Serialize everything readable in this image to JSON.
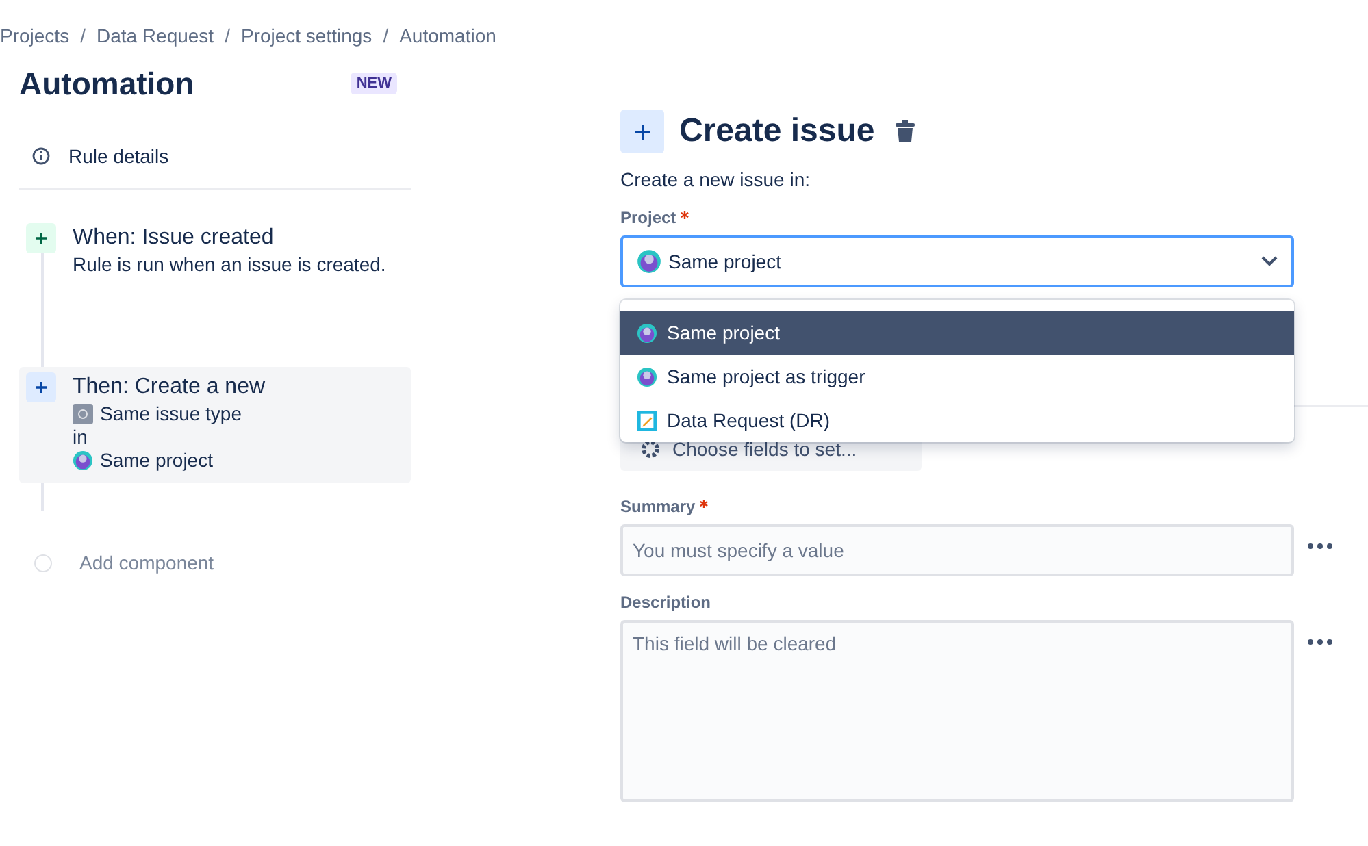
{
  "breadcrumbs": [
    {
      "kind": "link",
      "text": "Projects"
    },
    {
      "kind": "separator",
      "text": "/"
    },
    {
      "kind": "link",
      "text": "Data Request"
    },
    {
      "kind": "separator",
      "text": "/"
    },
    {
      "kind": "link",
      "text": "Project settings"
    },
    {
      "kind": "separator",
      "text": "/"
    },
    {
      "kind": "link",
      "text": "Automation"
    }
  ],
  "page": {
    "title": "Automation",
    "badge": "NEW"
  },
  "rule_details": {
    "label": "Rule details"
  },
  "components": [
    {
      "kind": "trigger",
      "title": "When: Issue created",
      "lines": [
        {
          "kind": "text",
          "text": "Rule is run when an issue is created."
        }
      ],
      "selected": false
    },
    {
      "kind": "action",
      "title": "Then: Create a new",
      "lines": [
        {
          "kind": "issue-type",
          "text": "Same issue type"
        },
        {
          "kind": "text",
          "text": "in"
        },
        {
          "kind": "project",
          "text": "Same project"
        }
      ],
      "selected": true
    }
  ],
  "add_component": "Add component",
  "panel": {
    "title": "Create issue",
    "intro": "Create a new issue in:",
    "project_field": {
      "label": "Project",
      "required": true,
      "value": "Same project",
      "expanded": true,
      "options": [
        {
          "label": "Same project",
          "kind": "project",
          "selected": true
        },
        {
          "label": "Same project as trigger",
          "kind": "project",
          "selected": false
        },
        {
          "label": "Data Request (DR)",
          "kind": "notepad",
          "selected": false
        }
      ]
    },
    "choose_fields": "Choose fields to set...",
    "fields": [
      {
        "kind": "input",
        "label": "Summary",
        "required": true,
        "placeholder": "You must specify a value"
      },
      {
        "kind": "textarea",
        "label": "Description",
        "required": false,
        "placeholder": "This field will be cleared"
      }
    ]
  }
}
